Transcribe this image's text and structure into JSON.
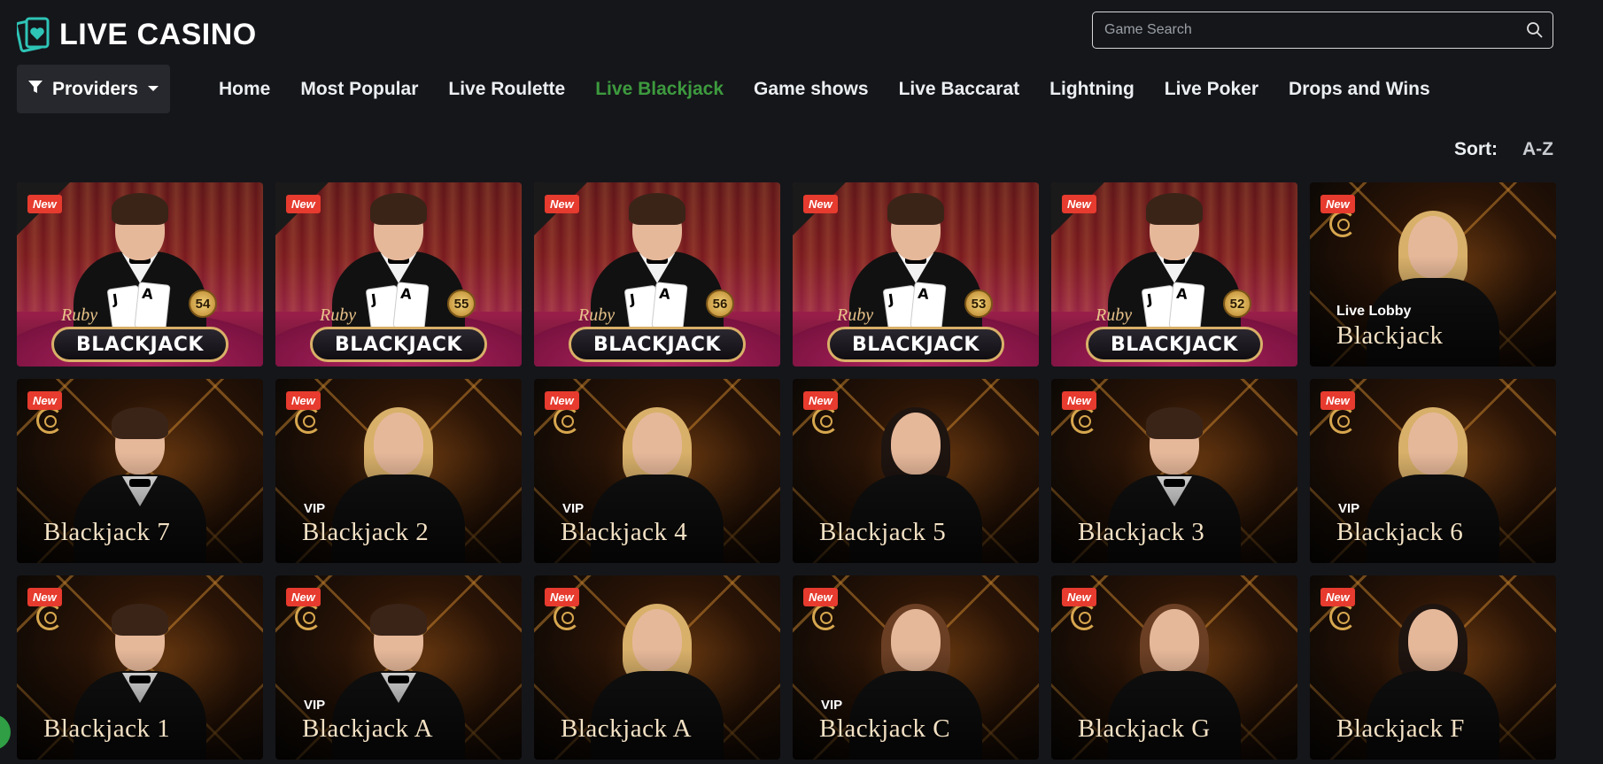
{
  "header": {
    "logo_text": "LIVE CASINO",
    "logo_icon": "cards-heart-icon",
    "brand_color": "#2ec4b6",
    "search": {
      "placeholder": "Game Search",
      "value": ""
    }
  },
  "nav": {
    "providers_label": "Providers",
    "items": [
      {
        "label": "Home",
        "active": false
      },
      {
        "label": "Most Popular",
        "active": false
      },
      {
        "label": "Live Roulette",
        "active": false
      },
      {
        "label": "Live Blackjack",
        "active": true
      },
      {
        "label": "Game shows",
        "active": false
      },
      {
        "label": "Live Baccarat",
        "active": false
      },
      {
        "label": "Lightning",
        "active": false
      },
      {
        "label": "Live Poker",
        "active": false
      },
      {
        "label": "Drops and Wins",
        "active": false
      }
    ],
    "active_color": "#3d9a3e"
  },
  "sort": {
    "label": "Sort:",
    "value": "A-Z"
  },
  "games": [
    {
      "style": "ruby",
      "new": "New",
      "ruby_label": "Ruby",
      "title": "BLACKJACK",
      "seat": "54",
      "card1": "J",
      "card2": "A"
    },
    {
      "style": "ruby",
      "new": "New",
      "ruby_label": "Ruby",
      "title": "BLACKJACK",
      "seat": "55",
      "card1": "J",
      "card2": "A"
    },
    {
      "style": "ruby",
      "new": "New",
      "ruby_label": "Ruby",
      "title": "BLACKJACK",
      "seat": "56",
      "card1": "J",
      "card2": "A"
    },
    {
      "style": "ruby",
      "new": "New",
      "ruby_label": "Ruby",
      "title": "BLACKJACK",
      "seat": "53",
      "card1": "J",
      "card2": "A"
    },
    {
      "style": "ruby",
      "new": "New",
      "ruby_label": "Ruby",
      "title": "BLACKJACK",
      "seat": "52",
      "card1": "J",
      "card2": "A"
    },
    {
      "style": "gold",
      "new": "New",
      "sub": "Live Lobby",
      "title": "Blackjack",
      "dealer": "female-blonde"
    },
    {
      "style": "gold",
      "new": "New",
      "sub": "",
      "title": "Blackjack 7",
      "dealer": "male"
    },
    {
      "style": "gold",
      "new": "New",
      "sub": "VIP",
      "title": "Blackjack 2",
      "dealer": "female-blonde"
    },
    {
      "style": "gold",
      "new": "New",
      "sub": "VIP",
      "title": "Blackjack 4",
      "dealer": "female-blonde"
    },
    {
      "style": "gold",
      "new": "New",
      "sub": "",
      "title": "Blackjack 5",
      "dealer": "female-dark"
    },
    {
      "style": "gold",
      "new": "New",
      "sub": "",
      "title": "Blackjack 3",
      "dealer": "male"
    },
    {
      "style": "gold",
      "new": "New",
      "sub": "VIP",
      "title": "Blackjack 6",
      "dealer": "female-blonde"
    },
    {
      "style": "gold",
      "new": "New",
      "sub": "",
      "title": "Blackjack 1",
      "dealer": "male"
    },
    {
      "style": "gold",
      "new": "New",
      "sub": "VIP",
      "title": "Blackjack A",
      "dealer": "male"
    },
    {
      "style": "gold",
      "new": "New",
      "sub": "",
      "title": "Blackjack A",
      "dealer": "female-blonde"
    },
    {
      "style": "gold",
      "new": "New",
      "sub": "VIP",
      "title": "Blackjack C",
      "dealer": "female-brown"
    },
    {
      "style": "gold",
      "new": "New",
      "sub": "",
      "title": "Blackjack G",
      "dealer": "female-brown"
    },
    {
      "style": "gold",
      "new": "New",
      "sub": "",
      "title": "Blackjack F",
      "dealer": "female-dark"
    }
  ]
}
